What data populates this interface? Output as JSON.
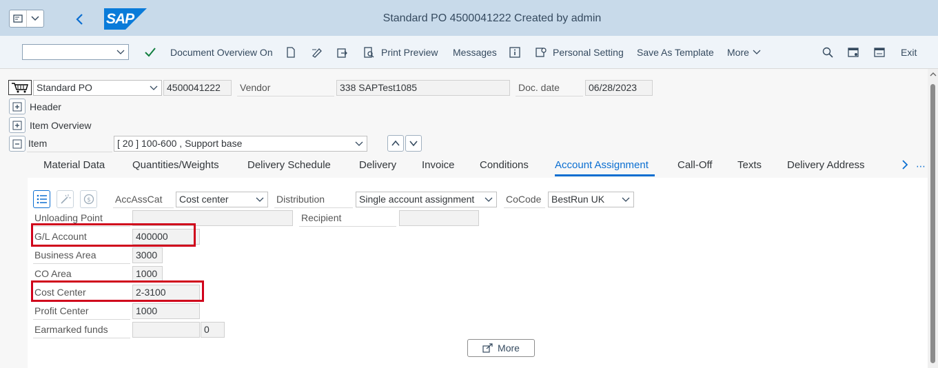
{
  "window": {
    "title": "Standard PO 4500041222 Created by admin",
    "logo": "SAP"
  },
  "toolbar": {
    "command_value": "",
    "items": [
      "Document Overview On",
      "Print Preview",
      "Messages",
      "Personal Setting",
      "Save As Template",
      "More",
      "Exit"
    ]
  },
  "header": {
    "po_type": "Standard PO",
    "po_number": "4500041222",
    "vendor_label": "Vendor",
    "vendor_value": "338 SAPTest1085",
    "docdate_label": "Doc. date",
    "docdate_value": "06/28/2023",
    "sections": [
      "Header",
      "Item Overview",
      "Item"
    ],
    "item_select": "[ 20 ] 100-600 , Support base"
  },
  "tabs": [
    "Material Data",
    "Quantities/Weights",
    "Delivery Schedule",
    "Delivery",
    "Invoice",
    "Conditions",
    "Account Assignment",
    "Call-Off",
    "Texts",
    "Delivery Address"
  ],
  "active_tab": "Account Assignment",
  "account": {
    "accasscat_label": "AccAssCat",
    "accasscat_value": "Cost center",
    "distribution_label": "Distribution",
    "distribution_value": "Single account assignment",
    "cocode_label": "CoCode",
    "cocode_value": "BestRun UK",
    "fields": [
      {
        "label": "Unloading Point",
        "value": ""
      },
      {
        "label": "G/L Account",
        "value": "400000"
      },
      {
        "label": "Business Area",
        "value": "3000"
      },
      {
        "label": "CO Area",
        "value": "1000"
      },
      {
        "label": "Cost Center",
        "value": "2-3100"
      },
      {
        "label": "Profit Center",
        "value": "1000"
      },
      {
        "label": "Earmarked funds",
        "value": ""
      }
    ],
    "recipient_label": "Recipient",
    "recipient_value": "",
    "earmarked_item": "0",
    "more_button": "More"
  },
  "colors": {
    "accent": "#0a6ed1",
    "highlight": "#d0021b",
    "titlebar": "#c8daea"
  }
}
